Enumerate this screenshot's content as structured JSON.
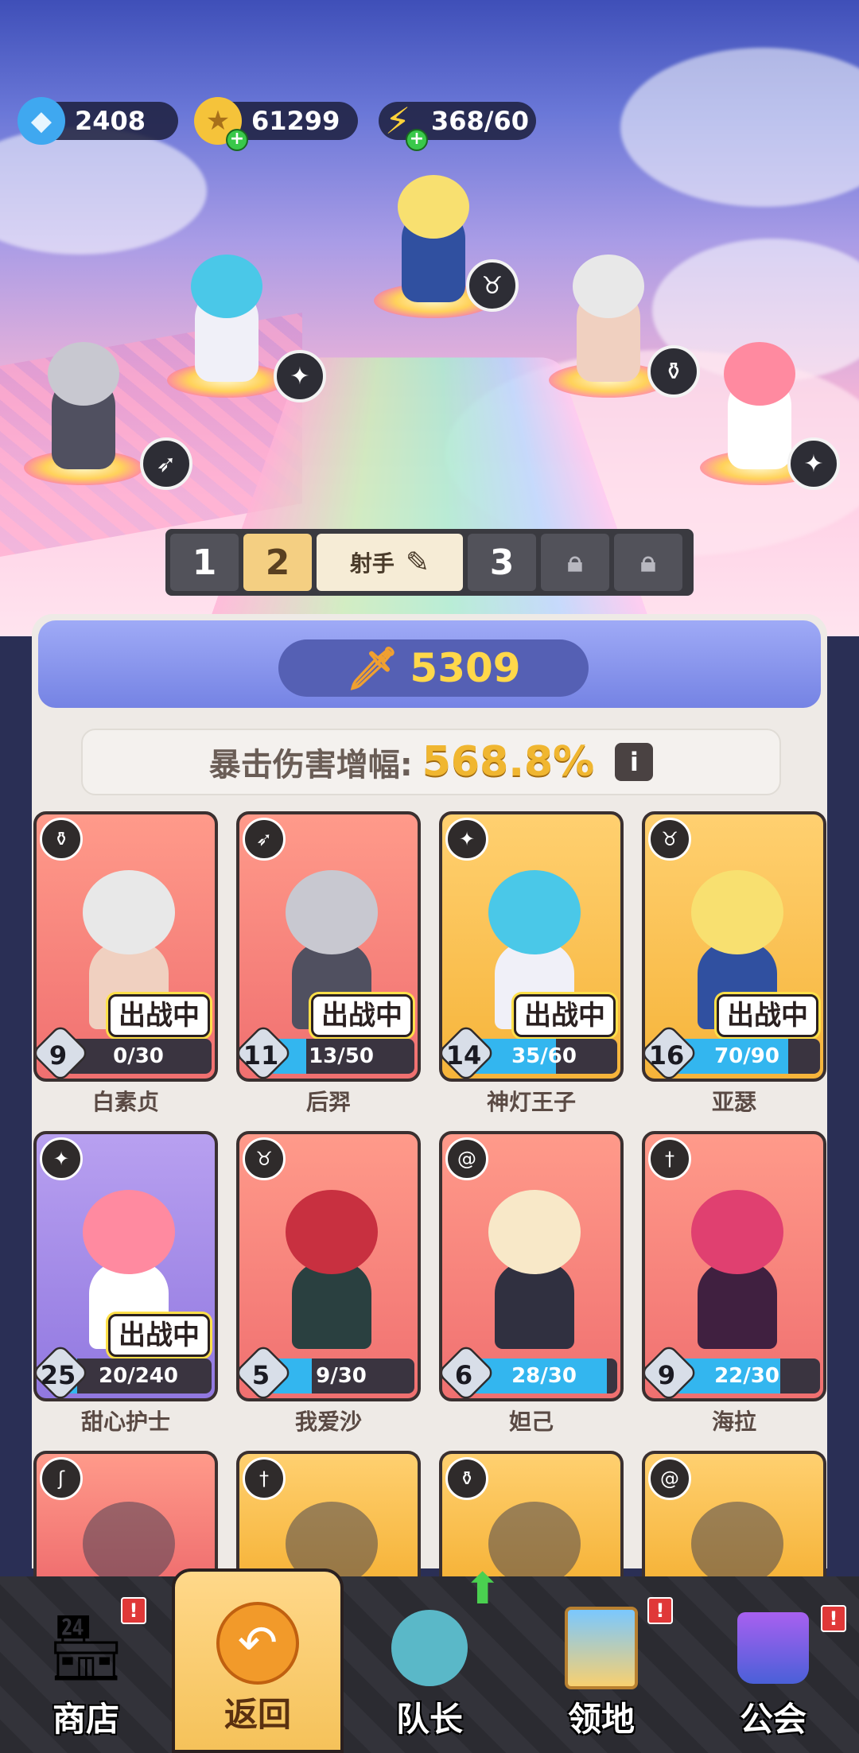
{
  "resources": {
    "gems": {
      "value": "2408",
      "icon": "diamond-icon"
    },
    "gold": {
      "value": "61299",
      "icon": "gold-coin-icon"
    },
    "energy": {
      "value": "368/60",
      "icon": "lightning-icon"
    }
  },
  "team_tabs": [
    {
      "label": "1"
    },
    {
      "label": "2",
      "active": true
    },
    {
      "label": "射手"
    },
    {
      "label": "3"
    },
    {
      "label": "",
      "locked": true
    },
    {
      "label": "",
      "locked": true
    }
  ],
  "power": {
    "value": "5309",
    "icon": "sword-icon"
  },
  "crit": {
    "label": "暴击伤害增幅:",
    "value": "568.8%"
  },
  "deployed_label": "出战中",
  "heroes": [
    {
      "name": "白素贞",
      "level": "9",
      "progress": "0/30",
      "fill": 0.0,
      "deployed": true,
      "bg": "red",
      "role": "potion-icon",
      "hair": "#e8e8e8",
      "outfit": "#f0d0c0"
    },
    {
      "name": "后羿",
      "level": "11",
      "progress": "13/50",
      "fill": 0.26,
      "deployed": true,
      "bg": "red",
      "role": "bow-icon",
      "hair": "#c8c8d0",
      "outfit": "#505060"
    },
    {
      "name": "神灯王子",
      "level": "14",
      "progress": "35/60",
      "fill": 0.58,
      "deployed": true,
      "bg": "gold",
      "role": "wings-icon",
      "hair": "#4ac8e8",
      "outfit": "#f0f0f8"
    },
    {
      "name": "亚瑟",
      "level": "16",
      "progress": "70/90",
      "fill": 0.78,
      "deployed": true,
      "bg": "gold",
      "role": "bull-icon",
      "hair": "#f8e070",
      "outfit": "#3050a0"
    },
    {
      "name": "甜心护士",
      "level": "25",
      "progress": "20/240",
      "fill": 0.08,
      "deployed": true,
      "bg": "purple",
      "role": "wings-icon",
      "hair": "#ff8aa0",
      "outfit": "#ffffff"
    },
    {
      "name": "我爱沙",
      "level": "5",
      "progress": "9/30",
      "fill": 0.3,
      "deployed": false,
      "bg": "red",
      "role": "bull-icon",
      "hair": "#c83040",
      "outfit": "#2a4040"
    },
    {
      "name": "妲己",
      "level": "6",
      "progress": "28/30",
      "fill": 0.93,
      "deployed": false,
      "bg": "red",
      "role": "spiral-icon",
      "hair": "#f8e8c8",
      "outfit": "#303040"
    },
    {
      "name": "海拉",
      "level": "9",
      "progress": "22/30",
      "fill": 0.73,
      "deployed": false,
      "bg": "red",
      "role": "dagger-icon",
      "hair": "#e04070",
      "outfit": "#402040"
    }
  ],
  "partial_cards": [
    {
      "bg": "red",
      "role": "staff-icon"
    },
    {
      "bg": "gold",
      "role": "dagger-icon"
    },
    {
      "bg": "gold",
      "role": "potion-icon"
    },
    {
      "bg": "gold",
      "role": "spiral-icon"
    }
  ],
  "nav": [
    {
      "label": "商店",
      "icon": "shop-icon",
      "alert": "!"
    },
    {
      "label": "返回",
      "icon": "return-icon",
      "active": true
    },
    {
      "label": "队长",
      "icon": "captain-icon",
      "upgrade": true
    },
    {
      "label": "领地",
      "icon": "territory-icon",
      "alert": "!"
    },
    {
      "label": "公会",
      "icon": "guild-icon",
      "alert": "!"
    }
  ]
}
